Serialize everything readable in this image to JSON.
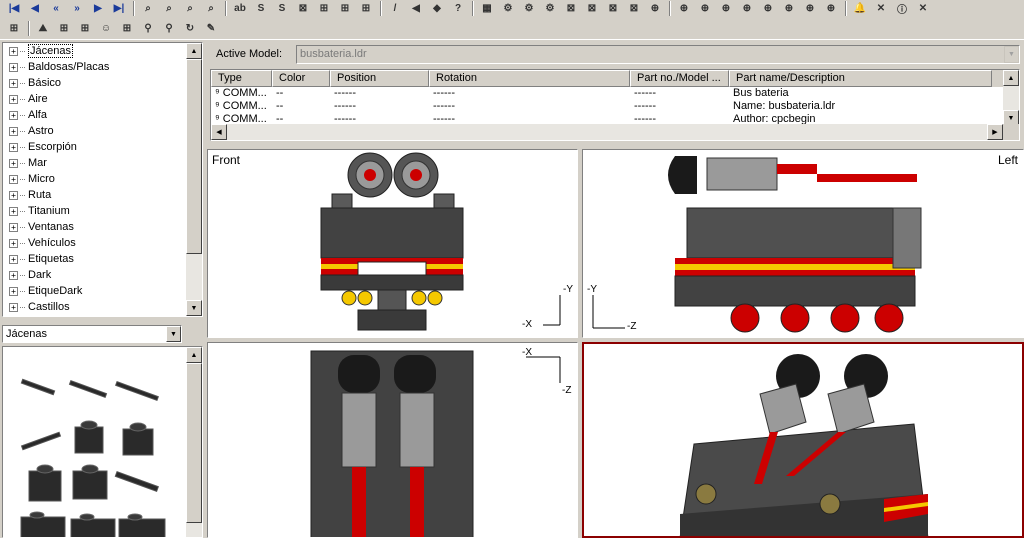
{
  "toolbar": {
    "row1_glyphs": [
      "|◀",
      "◀",
      "«",
      "»",
      "▶",
      "▶|",
      "⌕",
      "⌕",
      "⌕",
      "⌕",
      "ab",
      "S",
      "S",
      "⊠",
      "⊞",
      "⊞",
      "⊞",
      "/",
      "◀",
      "◆",
      "?",
      "▦",
      "⚙",
      "⚙",
      "⚙",
      "⊠",
      "⊠",
      "⊠",
      "⊠",
      "⊕",
      "⊕",
      "⊕",
      "⊕",
      "⊕",
      "⊕",
      "⊕",
      "⊕",
      "⊕",
      "🔔",
      "✕",
      "ⓘ",
      "✕"
    ],
    "row2_glyphs": [
      "⊞",
      "⛰",
      "⊞",
      "⊞",
      "☺",
      "⊞",
      "⚲",
      "⚲",
      "↻",
      "✎"
    ]
  },
  "tree": {
    "items": [
      "Jácenas",
      "Baldosas/Placas",
      "Básico",
      "Aire",
      "Alfa",
      "Astro",
      "Escorpión",
      "Mar",
      "Micro",
      "Ruta",
      "Titanium",
      "Ventanas",
      "Vehículos",
      "Etiquetas",
      "Dark",
      "EtiqueDark",
      "Castillos"
    ],
    "selected_index": 0
  },
  "category": {
    "value": "Jácenas"
  },
  "model": {
    "label": "Active Model:",
    "value": "busbateria.ldr"
  },
  "table": {
    "columns": [
      "Type",
      "Color",
      "Position",
      "Rotation",
      "Part no./Model ...",
      "Part name/Description"
    ],
    "rows": [
      [
        "COMM...",
        "--",
        "------",
        "------",
        "------",
        "Bus bateria"
      ],
      [
        "COMM...",
        "--",
        "------",
        "------",
        "------",
        "Name: busbateria.ldr"
      ],
      [
        "COMM...",
        "--",
        "------",
        "------",
        "------",
        "Author: cpcbegin"
      ]
    ]
  },
  "viewports": {
    "front": {
      "label": "Front",
      "axis_v": "-Y",
      "axis_h": "-X"
    },
    "left": {
      "label": "Left",
      "axis_v": "-Y",
      "axis_h": "-Z"
    },
    "top": {
      "axis_h": "-X",
      "axis_v": "-Z"
    }
  },
  "colors": {
    "accent_red": "#cc0000",
    "brick_dark": "#424242",
    "stripe_yellow": "#f5c800",
    "selected_frame": "#8b0000"
  }
}
